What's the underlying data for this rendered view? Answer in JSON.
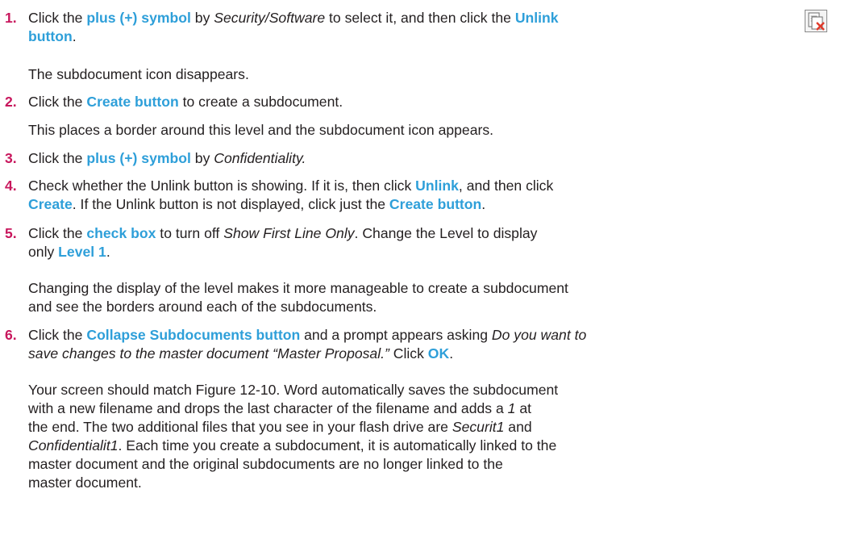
{
  "steps": [
    {
      "number": "1.",
      "line1": {
        "t1": "Click the ",
        "h1": "plus (+) symbol",
        "t2": " by ",
        "i1": "Security/Software",
        "t3": " to select it, and then click the ",
        "h2": "Unlink"
      },
      "line2": {
        "h1": "button",
        "t1": "."
      },
      "icon": "unlink-button-icon"
    },
    {
      "number": "2.",
      "line1": {
        "t1": "Click the ",
        "h1": "Create button",
        "t2": " to create a subdocument."
      }
    },
    {
      "number": "3.",
      "line1": {
        "t1": "Click the ",
        "h1": "plus (+) symbol",
        "t2": " by ",
        "i1": "Confidentiality."
      }
    },
    {
      "number": "4.",
      "line1": {
        "t1": "Check whether the Unlink button is showing. If it is, then click ",
        "h1": "Unlink",
        "t2": ", and then click"
      },
      "line2": {
        "h1": "Create",
        "t1": ". If the Unlink button is not displayed, click just the ",
        "h2": "Create button",
        "t2": "."
      }
    },
    {
      "number": "5.",
      "line1": {
        "t1": "Click the ",
        "h1": "check box",
        "t2": " to turn off ",
        "i1": "Show First Line Only",
        "t3": ". Change the Level to display"
      },
      "line2": {
        "t1": "only ",
        "h1": "Level 1",
        "t2": "."
      }
    },
    {
      "number": "6.",
      "line1": {
        "t1": "Click the ",
        "h1": "Collapse Subdocuments button",
        "t2": " and a prompt appears asking ",
        "i1": "Do you want to"
      },
      "line2": {
        "i1": "save changes to the master document “Master Proposal.”",
        "t1": " Click ",
        "h1": "OK",
        "t2": "."
      }
    }
  ],
  "notes": {
    "after_step1": "The subdocument icon disappears.",
    "after_step2": "This places a border around this level and the subdocument icon appears.",
    "after_step5": {
      "l1": "Changing the display of the level makes it more manageable to create a subdocument",
      "l2": "and see the borders around each of the subdocuments."
    },
    "after_step6": {
      "l1": "Your screen should match Figure 12-10. Word automatically saves the subdocument",
      "l2a": "with a new filename and drops the last character of the filename and adds a ",
      "l2i": "1",
      "l2b": " at",
      "l3a": "the end. The two additional files that you see in your flash drive are ",
      "l3i": "Securit1",
      "l3b": " and",
      "l4i": "Confidentialit1",
      "l4a": ". Each time you create a subdocument, it is automatically linked to the",
      "l5": "master document and the original subdocuments are no longer linked to the",
      "l6": "master document."
    }
  },
  "colors": {
    "step_number": "#c8175d",
    "highlight": "#2e9fd9",
    "body_text": "#231f20"
  }
}
